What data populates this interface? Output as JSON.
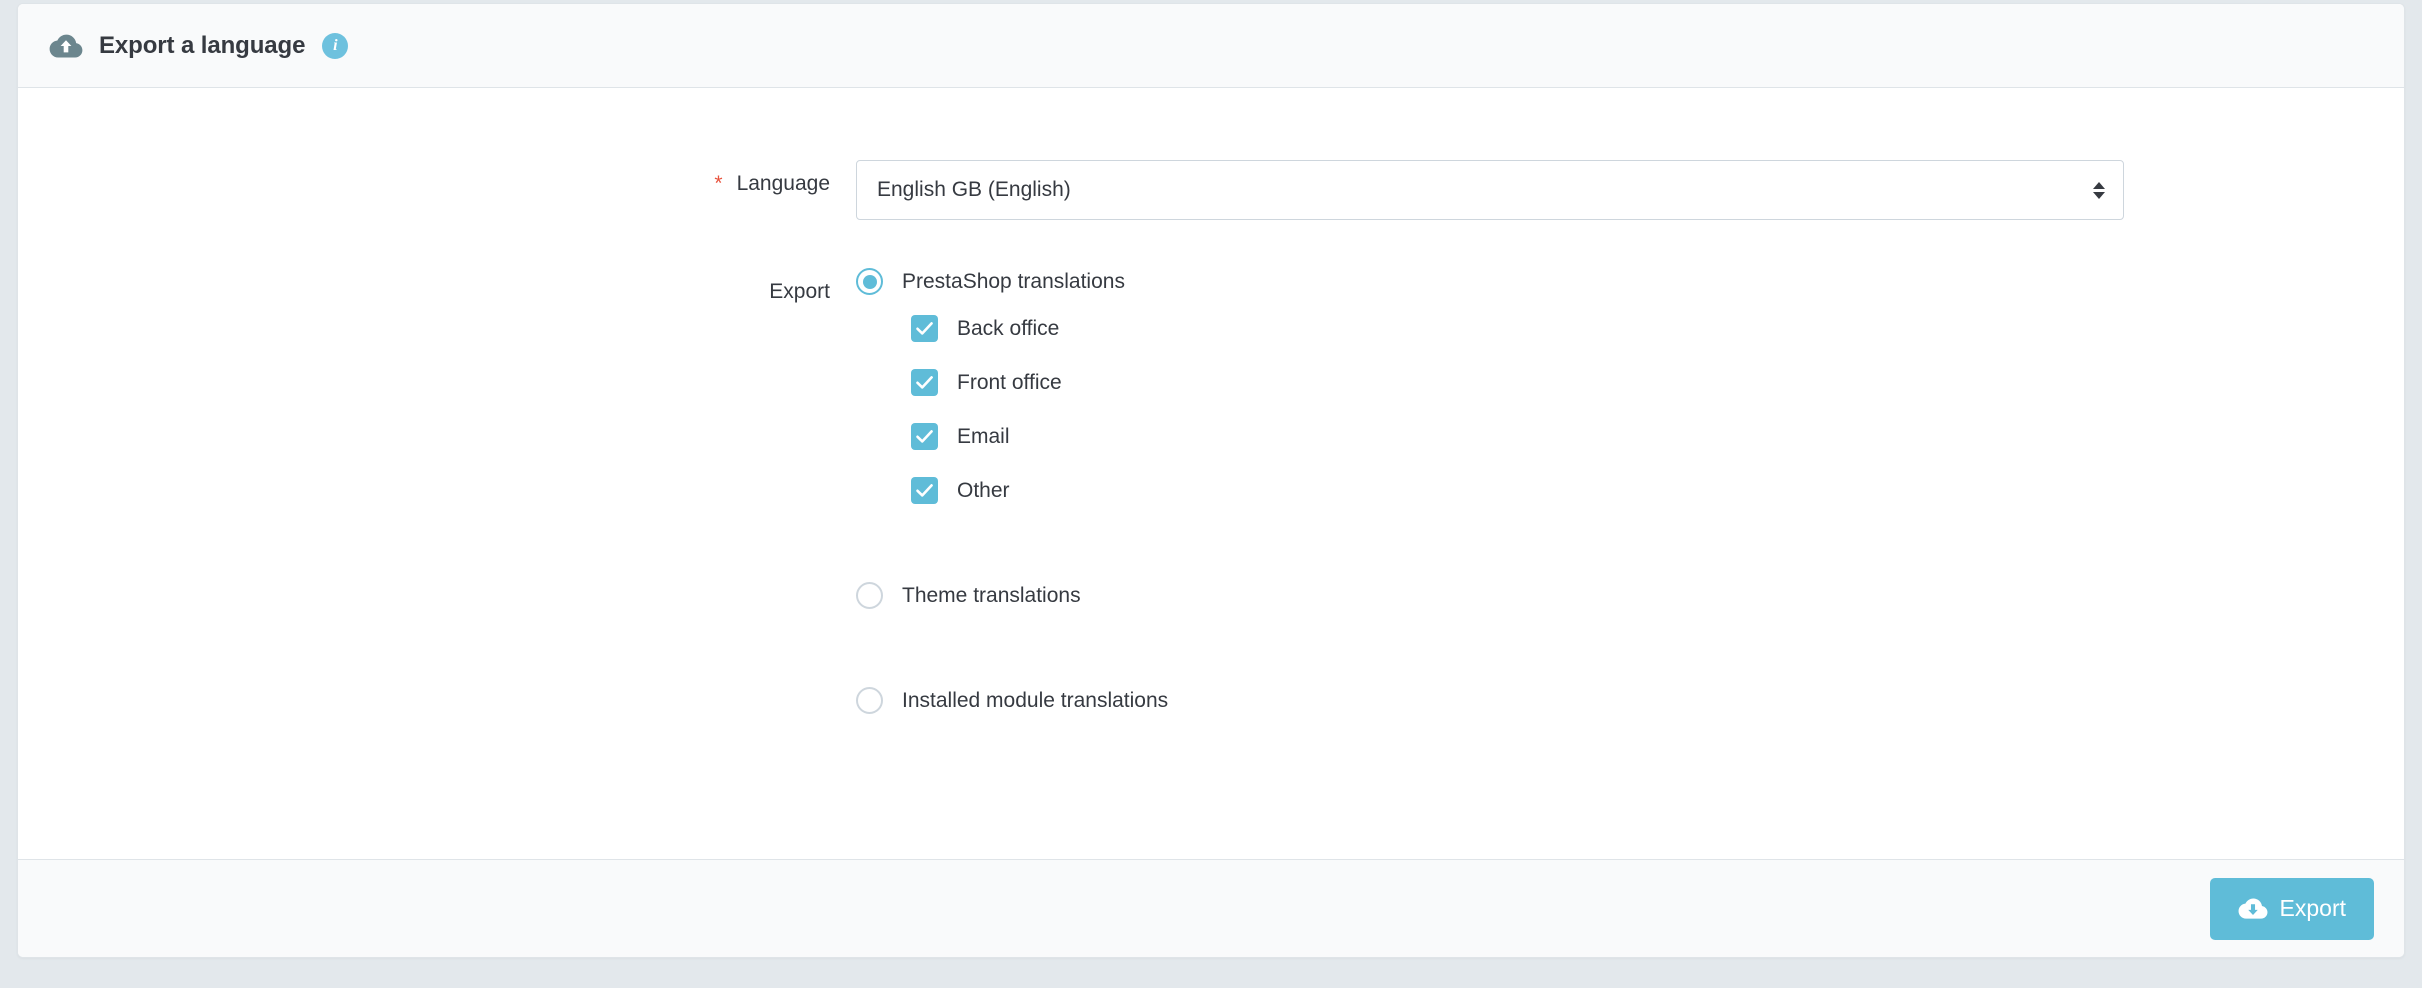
{
  "header": {
    "icon": "cloud-upload-icon",
    "title": "Export a language",
    "info_icon": "info-icon",
    "info_glyph": "i"
  },
  "form": {
    "language": {
      "required_marker": "*",
      "label": "Language",
      "selected_value": "English GB (English)",
      "options": [
        "English GB (English)"
      ]
    },
    "export": {
      "label": "Export",
      "radios": [
        {
          "label": "PrestaShop translations",
          "checked": true
        },
        {
          "label": "Theme translations",
          "checked": false
        },
        {
          "label": "Installed module translations",
          "checked": false
        }
      ],
      "checkboxes": [
        {
          "label": "Back office",
          "checked": true
        },
        {
          "label": "Front office",
          "checked": true
        },
        {
          "label": "Email",
          "checked": true
        },
        {
          "label": "Other",
          "checked": true
        }
      ]
    }
  },
  "footer": {
    "export_button_label": "Export",
    "export_button_icon": "cloud-download-icon"
  },
  "colors": {
    "accent": "#5fbcd8",
    "required": "#e8543f",
    "text": "#363a41",
    "panel_bg": "#ffffff",
    "header_bg": "#f9fafb",
    "border": "#dfe4e8",
    "page_bg": "#e3e8ec",
    "header_icon": "#6c868e"
  }
}
